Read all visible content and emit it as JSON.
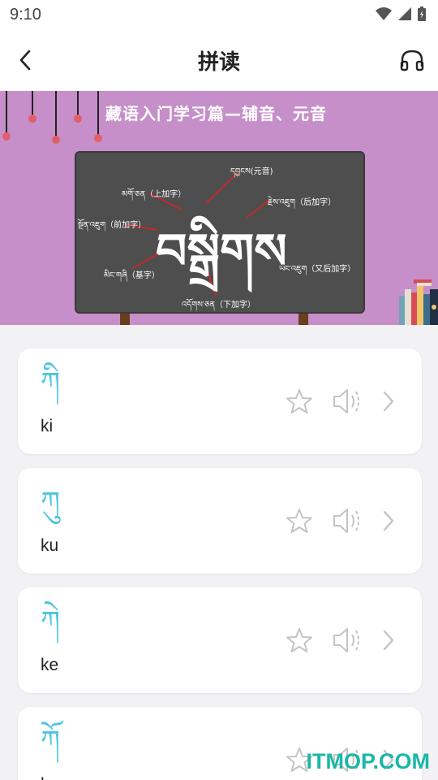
{
  "status": {
    "time": "9:10"
  },
  "header": {
    "title": "拼读",
    "back_icon": "chevron-left-icon",
    "audio_icon": "headphones-icon"
  },
  "banner": {
    "title": "藏语入门学习篇—辅音、元音",
    "main_word": "བསྒྲིགས",
    "labels": {
      "vowel": "དབྱངས(元音)",
      "head": "མགོ་ཅན（上加字）",
      "suffix": "རྗེས་འཇུག（后加字）",
      "prefix": "སྔོན་འཇུག（前加字）",
      "postsuffix": "ཡང་འཇུག（又后加字）",
      "root": "མིང་གཞི（基字）",
      "subjoined": "འདོགས་ཅན（下加字）"
    },
    "colors": {
      "background": "#c68fc9",
      "board": "#4e4e4e",
      "lines": "#c0282c",
      "bulbs": "#e15e6a"
    }
  },
  "items": [
    {
      "tibetan": "ཀི",
      "roman": "ki"
    },
    {
      "tibetan": "ཀུ",
      "roman": "ku"
    },
    {
      "tibetan": "ཀེ",
      "roman": "ke"
    },
    {
      "tibetan": "ཀོ",
      "roman": "ko"
    }
  ],
  "item_icons": {
    "favorite": "star-outline-icon",
    "play": "speaker-icon",
    "open": "chevron-right-icon"
  },
  "accent_color": "#4dc6dd",
  "watermark": "ITMOP.COM"
}
